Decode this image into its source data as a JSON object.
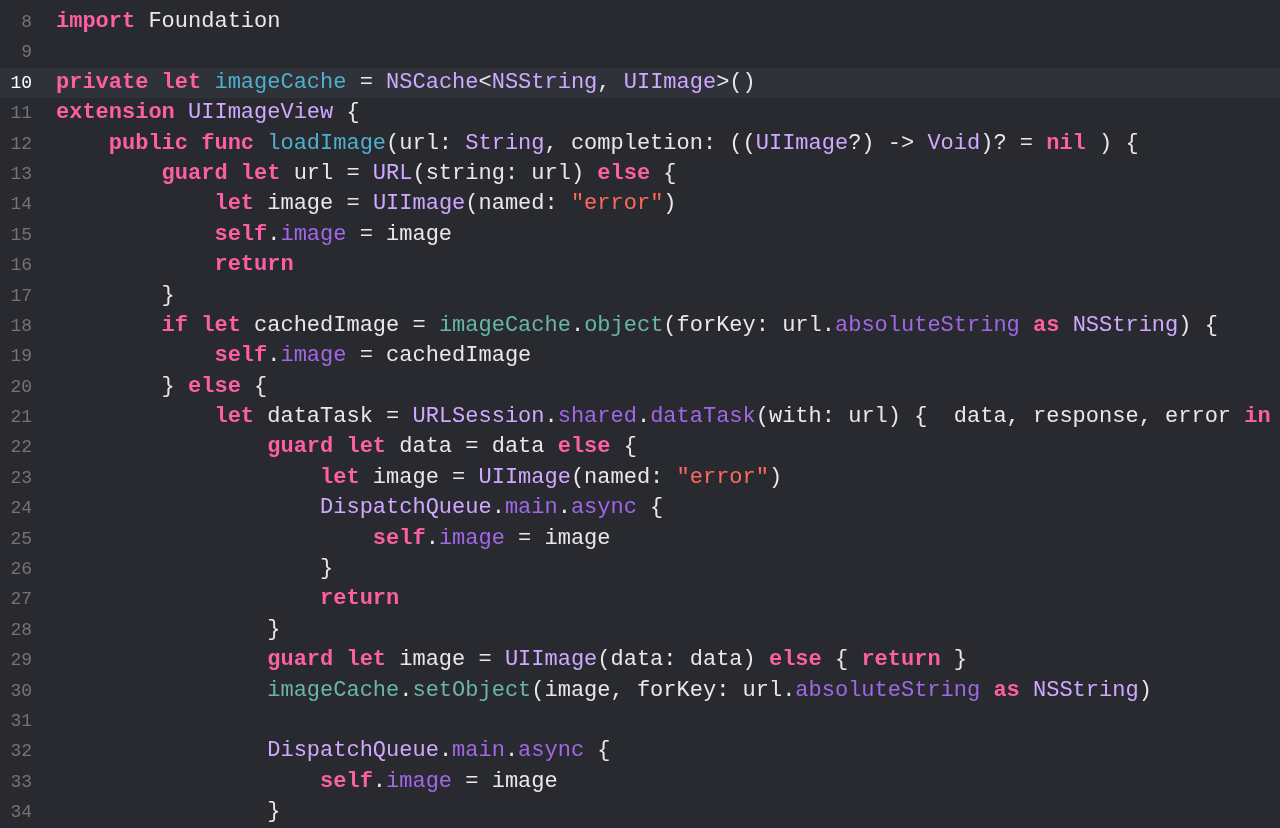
{
  "editor": {
    "lines": [
      {
        "number": "8",
        "current": false,
        "tokens": [
          {
            "kind": "keyword",
            "text": "import"
          },
          {
            "kind": "plain",
            "text": " Foundation"
          }
        ]
      },
      {
        "number": "9",
        "current": false
      },
      {
        "number": "10",
        "current": true,
        "tokens": [
          {
            "kind": "keyword",
            "text": "private let "
          },
          {
            "kind": "decl",
            "text": "imageCache"
          },
          {
            "kind": "plain",
            "text": " = "
          },
          {
            "kind": "type",
            "text": "NSCache"
          },
          {
            "kind": "plain",
            "text": "<"
          },
          {
            "kind": "type",
            "text": "NSString"
          },
          {
            "kind": "plain",
            "text": ", "
          },
          {
            "kind": "type",
            "text": "UIImage"
          },
          {
            "kind": "plain",
            "text": ">()"
          }
        ]
      },
      {
        "number": "11",
        "current": false,
        "tokens": [
          {
            "kind": "keyword",
            "text": "extension "
          },
          {
            "kind": "type",
            "text": "UIImageView"
          },
          {
            "kind": "plain",
            "text": " {"
          }
        ]
      },
      {
        "number": "12",
        "current": false,
        "tokens": [
          {
            "kind": "keyword",
            "text": "    public func "
          },
          {
            "kind": "decl",
            "text": "loadImage"
          },
          {
            "kind": "plain",
            "text": "(url: "
          },
          {
            "kind": "type",
            "text": "String"
          },
          {
            "kind": "plain",
            "text": ", completion: (("
          },
          {
            "kind": "type",
            "text": "UIImage"
          },
          {
            "kind": "plain",
            "text": "?) -> "
          },
          {
            "kind": "type",
            "text": "Void"
          },
          {
            "kind": "plain",
            "text": ")? = "
          },
          {
            "kind": "keyword",
            "text": "nil"
          },
          {
            "kind": "plain",
            "text": " ) {"
          }
        ]
      },
      {
        "number": "13",
        "current": false,
        "tokens": [
          {
            "kind": "keyword",
            "text": "        guard let"
          },
          {
            "kind": "plain",
            "text": " url = "
          },
          {
            "kind": "type",
            "text": "URL"
          },
          {
            "kind": "plain",
            "text": "(string: url) "
          },
          {
            "kind": "keyword",
            "text": "else"
          },
          {
            "kind": "plain",
            "text": " {"
          }
        ]
      },
      {
        "number": "14",
        "current": false,
        "tokens": [
          {
            "kind": "keyword",
            "text": "            let"
          },
          {
            "kind": "plain",
            "text": " image = "
          },
          {
            "kind": "type",
            "text": "UIImage"
          },
          {
            "kind": "plain",
            "text": "(named: "
          },
          {
            "kind": "string",
            "text": "\"error\""
          },
          {
            "kind": "plain",
            "text": ")"
          }
        ]
      },
      {
        "number": "15",
        "current": false,
        "tokens": [
          {
            "kind": "keyword",
            "text": "            self"
          },
          {
            "kind": "plain",
            "text": "."
          },
          {
            "kind": "member",
            "text": "image"
          },
          {
            "kind": "plain",
            "text": " = image"
          }
        ]
      },
      {
        "number": "16",
        "current": false,
        "tokens": [
          {
            "kind": "keyword",
            "text": "            return"
          }
        ]
      },
      {
        "number": "17",
        "current": false,
        "tokens": [
          {
            "kind": "plain",
            "text": "        }"
          }
        ]
      },
      {
        "number": "18",
        "current": false,
        "tokens": [
          {
            "kind": "keyword",
            "text": "        if let"
          },
          {
            "kind": "plain",
            "text": " cachedImage = "
          },
          {
            "kind": "project",
            "text": "imageCache"
          },
          {
            "kind": "plain",
            "text": "."
          },
          {
            "kind": "project",
            "text": "object"
          },
          {
            "kind": "plain",
            "text": "(forKey: url."
          },
          {
            "kind": "member",
            "text": "absoluteString"
          },
          {
            "kind": "keyword",
            "text": " as "
          },
          {
            "kind": "type",
            "text": "NSString"
          },
          {
            "kind": "plain",
            "text": ") {"
          }
        ]
      },
      {
        "number": "19",
        "current": false,
        "tokens": [
          {
            "kind": "keyword",
            "text": "            self"
          },
          {
            "kind": "plain",
            "text": "."
          },
          {
            "kind": "member",
            "text": "image"
          },
          {
            "kind": "plain",
            "text": " = cachedImage"
          }
        ]
      },
      {
        "number": "20",
        "current": false,
        "tokens": [
          {
            "kind": "plain",
            "text": "        } "
          },
          {
            "kind": "keyword",
            "text": "else"
          },
          {
            "kind": "plain",
            "text": " {"
          }
        ]
      },
      {
        "number": "21",
        "current": false,
        "tokens": [
          {
            "kind": "keyword",
            "text": "            let"
          },
          {
            "kind": "plain",
            "text": " dataTask = "
          },
          {
            "kind": "type",
            "text": "URLSession"
          },
          {
            "kind": "plain",
            "text": "."
          },
          {
            "kind": "member",
            "text": "shared"
          },
          {
            "kind": "plain",
            "text": "."
          },
          {
            "kind": "member",
            "text": "dataTask"
          },
          {
            "kind": "plain",
            "text": "(with: url) {  data, response, error "
          },
          {
            "kind": "keyword",
            "text": "in"
          }
        ]
      },
      {
        "number": "22",
        "current": false,
        "tokens": [
          {
            "kind": "keyword",
            "text": "                guard let"
          },
          {
            "kind": "plain",
            "text": " data = data "
          },
          {
            "kind": "keyword",
            "text": "else"
          },
          {
            "kind": "plain",
            "text": " {"
          }
        ]
      },
      {
        "number": "23",
        "current": false,
        "tokens": [
          {
            "kind": "keyword",
            "text": "                    let"
          },
          {
            "kind": "plain",
            "text": " image = "
          },
          {
            "kind": "type",
            "text": "UIImage"
          },
          {
            "kind": "plain",
            "text": "(named: "
          },
          {
            "kind": "string",
            "text": "\"error\""
          },
          {
            "kind": "plain",
            "text": ")"
          }
        ]
      },
      {
        "number": "24",
        "current": false,
        "tokens": [
          {
            "kind": "type",
            "text": "                    DispatchQueue"
          },
          {
            "kind": "plain",
            "text": "."
          },
          {
            "kind": "member",
            "text": "main"
          },
          {
            "kind": "plain",
            "text": "."
          },
          {
            "kind": "member",
            "text": "async"
          },
          {
            "kind": "plain",
            "text": " {"
          }
        ]
      },
      {
        "number": "25",
        "current": false,
        "tokens": [
          {
            "kind": "keyword",
            "text": "                        self"
          },
          {
            "kind": "plain",
            "text": "."
          },
          {
            "kind": "member",
            "text": "image"
          },
          {
            "kind": "plain",
            "text": " = image"
          }
        ]
      },
      {
        "number": "26",
        "current": false,
        "tokens": [
          {
            "kind": "plain",
            "text": "                    }"
          }
        ]
      },
      {
        "number": "27",
        "current": false,
        "tokens": [
          {
            "kind": "keyword",
            "text": "                    return"
          }
        ]
      },
      {
        "number": "28",
        "current": false,
        "tokens": [
          {
            "kind": "plain",
            "text": "                }"
          }
        ]
      },
      {
        "number": "29",
        "current": false,
        "tokens": [
          {
            "kind": "keyword",
            "text": "                guard let"
          },
          {
            "kind": "plain",
            "text": " image = "
          },
          {
            "kind": "type",
            "text": "UIImage"
          },
          {
            "kind": "plain",
            "text": "(data: data) "
          },
          {
            "kind": "keyword",
            "text": "else"
          },
          {
            "kind": "plain",
            "text": " { "
          },
          {
            "kind": "keyword",
            "text": "return"
          },
          {
            "kind": "plain",
            "text": " }"
          }
        ]
      },
      {
        "number": "30",
        "current": false,
        "tokens": [
          {
            "kind": "project",
            "text": "                imageCache"
          },
          {
            "kind": "plain",
            "text": "."
          },
          {
            "kind": "project",
            "text": "setObject"
          },
          {
            "kind": "plain",
            "text": "(image, forKey: url."
          },
          {
            "kind": "member",
            "text": "absoluteString"
          },
          {
            "kind": "keyword",
            "text": " as "
          },
          {
            "kind": "type",
            "text": "NSString"
          },
          {
            "kind": "plain",
            "text": ")"
          }
        ]
      },
      {
        "number": "31",
        "current": false
      },
      {
        "number": "32",
        "current": false,
        "tokens": [
          {
            "kind": "type",
            "text": "                DispatchQueue"
          },
          {
            "kind": "plain",
            "text": "."
          },
          {
            "kind": "member",
            "text": "main"
          },
          {
            "kind": "plain",
            "text": "."
          },
          {
            "kind": "member",
            "text": "async"
          },
          {
            "kind": "plain",
            "text": " {"
          }
        ]
      },
      {
        "number": "33",
        "current": false,
        "tokens": [
          {
            "kind": "keyword",
            "text": "                    self"
          },
          {
            "kind": "plain",
            "text": "."
          },
          {
            "kind": "member",
            "text": "image"
          },
          {
            "kind": "plain",
            "text": " = image"
          }
        ]
      },
      {
        "number": "34",
        "current": false,
        "tokens": [
          {
            "kind": "plain",
            "text": "                }"
          }
        ]
      }
    ]
  }
}
